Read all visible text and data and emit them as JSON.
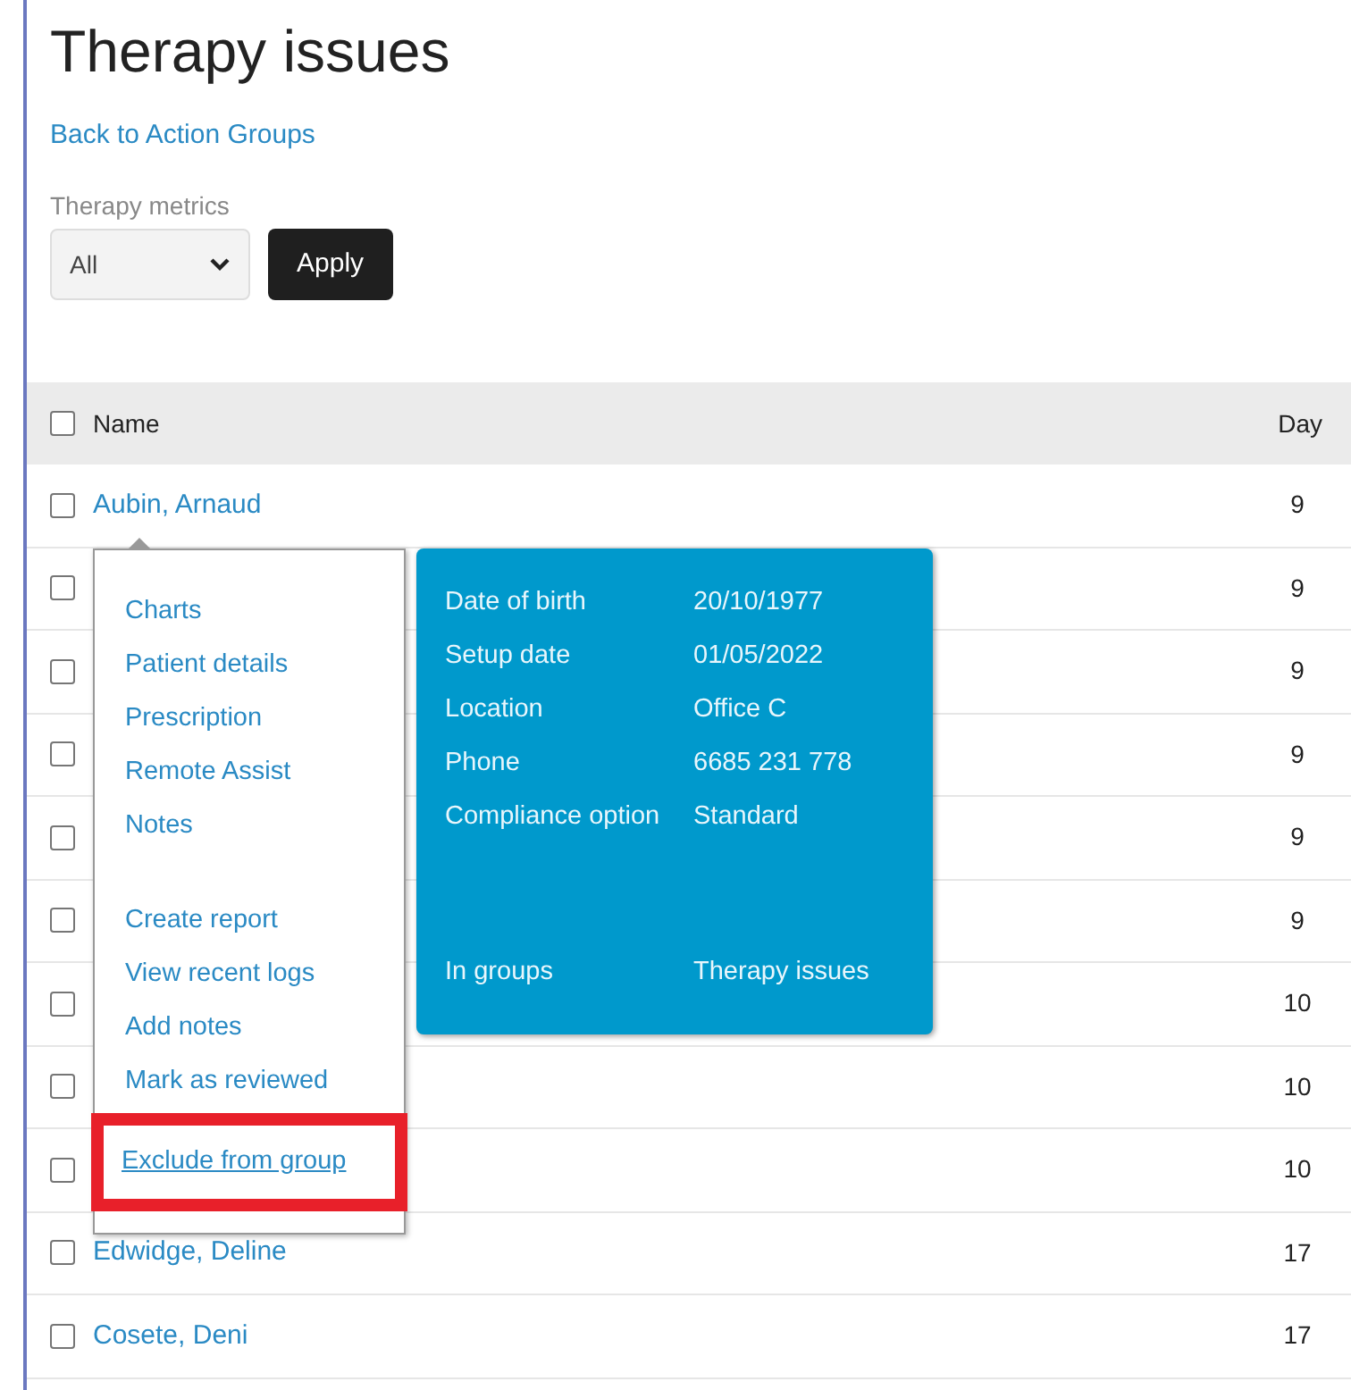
{
  "title": "Therapy issues",
  "back_link": "Back to Action Groups",
  "filter": {
    "label": "Therapy metrics",
    "value": "All",
    "button": "Apply"
  },
  "table": {
    "columns": [
      {
        "label": "Name",
        "checked": false
      },
      {
        "label": "Day"
      }
    ],
    "rows": [
      {
        "name": "Aubin, Arnaud",
        "day": "9",
        "checked": false
      },
      {
        "day": "9",
        "checked": false
      },
      {
        "day": "9",
        "checked": false
      },
      {
        "day": "9",
        "checked": false
      },
      {
        "day": "9",
        "checked": false
      },
      {
        "day": "9",
        "checked": false
      },
      {
        "day": "10",
        "checked": false
      },
      {
        "day": "10",
        "checked": false
      },
      {
        "day": "10",
        "checked": false
      },
      {
        "name": "Edwidge, Deline",
        "day": "17",
        "checked": false
      },
      {
        "name": "Cosete, Deni",
        "day": "17",
        "checked": false
      }
    ]
  },
  "context_menu": {
    "sections": [
      [
        {
          "label": "Charts",
          "highlighted": false
        },
        {
          "label": "Patient details",
          "highlighted": false
        },
        {
          "label": "Prescription",
          "highlighted": false
        },
        {
          "label": "Remote Assist",
          "highlighted": false
        },
        {
          "label": "Notes",
          "highlighted": false
        }
      ],
      [
        {
          "label": "Create report",
          "highlighted": false
        },
        {
          "label": "View recent logs",
          "highlighted": false
        },
        {
          "label": "Add notes",
          "highlighted": false
        },
        {
          "label": "Mark as reviewed",
          "highlighted": false
        },
        {
          "label": "Exclude from group",
          "highlighted": true
        }
      ]
    ]
  },
  "info_panel": {
    "sections": [
      [
        {
          "label": "Date of birth",
          "value": "20/10/1977"
        },
        {
          "label": "Setup date",
          "value": "01/05/2022"
        },
        {
          "label": "Location",
          "value": "Office C"
        },
        {
          "label": "Phone",
          "value": "6685 231 778"
        },
        {
          "label": "Compliance option",
          "value": "Standard"
        }
      ],
      [
        {
          "label": "In groups",
          "value": "Therapy issues"
        }
      ]
    ]
  }
}
